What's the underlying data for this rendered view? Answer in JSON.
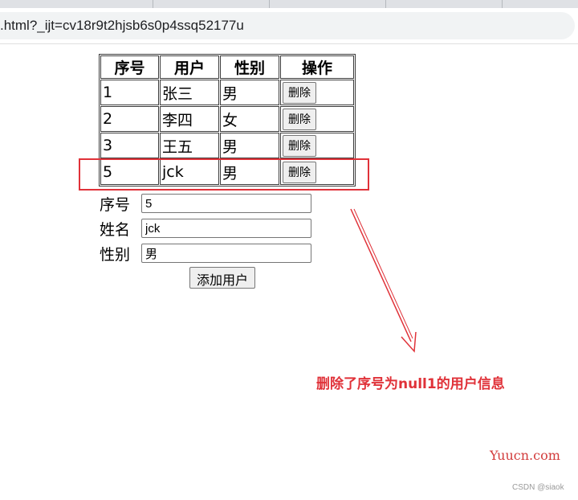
{
  "browser": {
    "url_text": ".html?_ijt=cv18r9t2hjsb6s0p4ssq52177u"
  },
  "table": {
    "headers": [
      "序号",
      "用户",
      "性别",
      "操作"
    ],
    "rows": [
      {
        "id": "1",
        "user": "张三",
        "sex": "男",
        "action": "删除"
      },
      {
        "id": "2",
        "user": "李四",
        "sex": "女",
        "action": "删除"
      },
      {
        "id": "3",
        "user": "王五",
        "sex": "男",
        "action": "删除"
      },
      {
        "id": "5",
        "user": "jck",
        "sex": "男",
        "action": "删除"
      }
    ]
  },
  "form": {
    "id_label": "序号",
    "id_value": "5",
    "name_label": "姓名",
    "name_value": "jck",
    "sex_label": "性别",
    "sex_value": "男",
    "submit_label": "添加用户"
  },
  "annotation": {
    "text": "删除了序号为null1的用户信息",
    "color": "#e03239"
  },
  "watermark": {
    "text": "Yuucn.com"
  },
  "credit": {
    "text": "CSDN @siaok"
  }
}
